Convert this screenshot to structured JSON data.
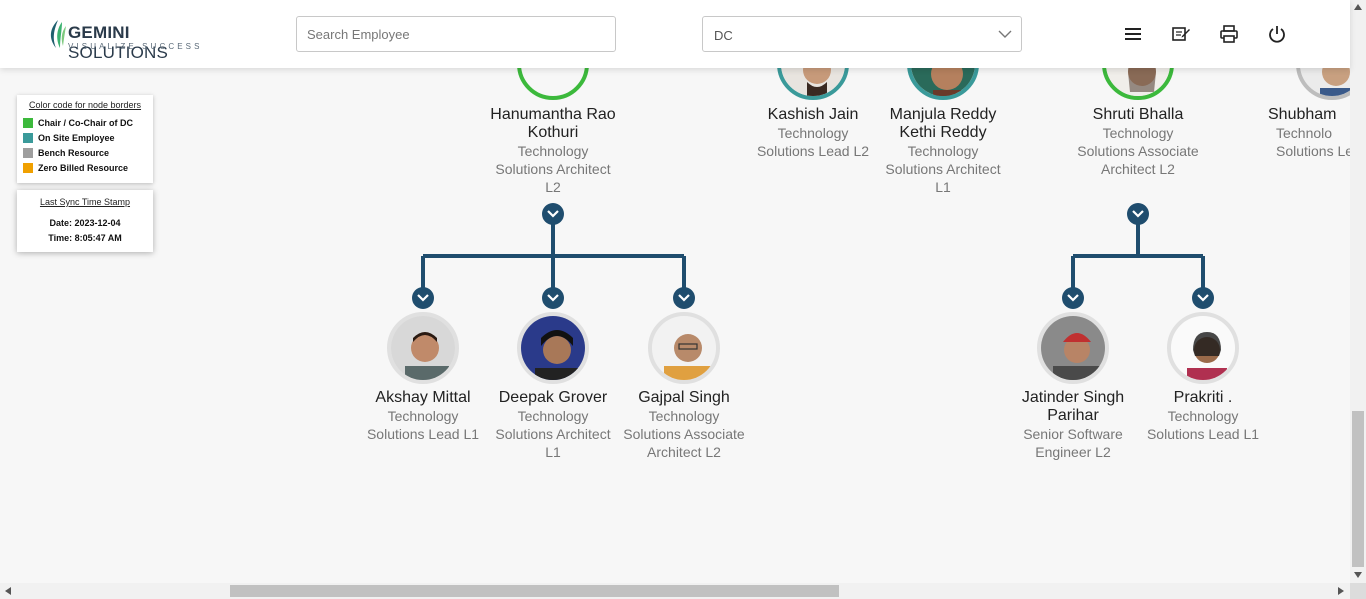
{
  "header": {
    "logo": {
      "name_bold": "GEMINI",
      "name_rest": " SOLUTIONS",
      "tagline": "VISUALIZE SUCCESS"
    },
    "search_placeholder": "Search Employee",
    "dc_select": {
      "value": "DC"
    },
    "icons": [
      "menu-icon",
      "edit-icon",
      "print-icon",
      "power-icon"
    ]
  },
  "legend": {
    "title": "Color code for node borders",
    "items": [
      {
        "label": "Chair / Co-Chair of DC",
        "color": "#3cb93c"
      },
      {
        "label": "On Site Employee",
        "color": "#3a9a9a"
      },
      {
        "label": "Bench Resource",
        "color": "#9e9e9e"
      },
      {
        "label": "Zero Billed Resource",
        "color": "#f0a000"
      }
    ]
  },
  "sync": {
    "title": "Last Sync Time Stamp",
    "date": "Date: 2023-12-04",
    "time": "Time: 8:05:47 AM"
  },
  "nodes": [
    {
      "name": "Hanumantha Rao Kothuri",
      "title": "Technology Solutions Architect L2",
      "border": "#3cb93c"
    },
    {
      "name": "Kashish Jain",
      "title": "Technology Solutions Lead L2",
      "border": "#3a9a9a"
    },
    {
      "name": "Manjula Reddy Kethi Reddy",
      "title": "Technology Solutions Architect L1",
      "border": "#3a9a9a"
    },
    {
      "name": "Shruti Bhalla",
      "title": "Technology Solutions Associate Architect L2",
      "border": "#3cb93c"
    },
    {
      "name": "Shubham",
      "title": "Technolo Solutions Le",
      "border": "#bdbdbd"
    },
    {
      "name": "Akshay Mittal",
      "title": "Technology Solutions Lead L1",
      "border": "#e0e0e0"
    },
    {
      "name": "Deepak Grover",
      "title": "Technology Solutions Architect L1",
      "border": "#e0e0e0"
    },
    {
      "name": "Gajpal Singh",
      "title": "Technology Solutions Associate Architect L2",
      "border": "#e0e0e0"
    },
    {
      "name": "Jatinder Singh Parihar",
      "title": "Senior Software Engineer L2",
      "border": "#e0e0e0"
    },
    {
      "name": "Prakriti .",
      "title": "Technology Solutions Lead L1",
      "border": "#e0e0e0"
    }
  ]
}
